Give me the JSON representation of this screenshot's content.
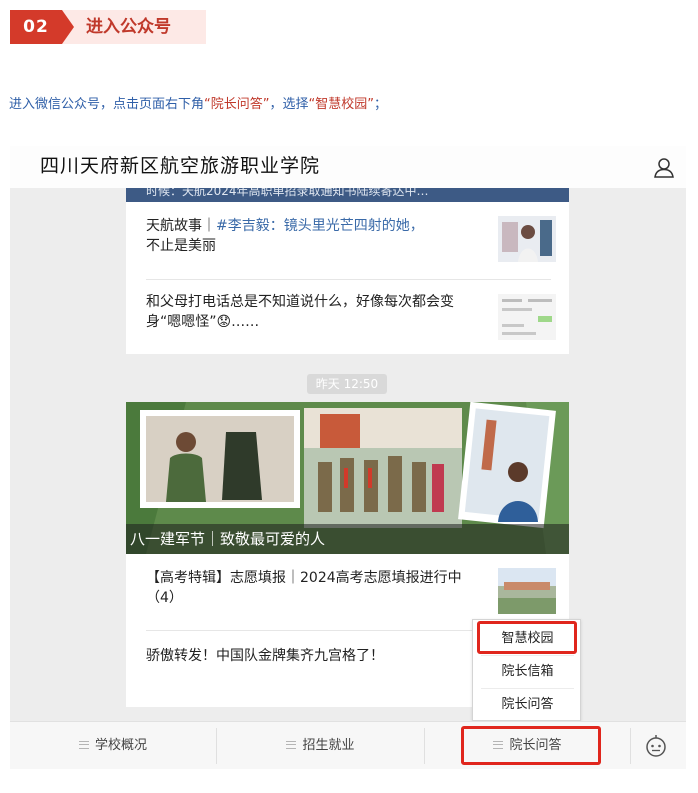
{
  "step": {
    "number": "02",
    "title": "进入公众号"
  },
  "instruction": {
    "part1": "进入微信公众号，点击页面右下角",
    "quote1": "“院长问答”",
    "part2": "，选择",
    "quote2": "“智慧校园”",
    "part3": "；"
  },
  "account": {
    "name": "四川天府新区航空旅游职业学院"
  },
  "feed": {
    "banner_text": "时候：天航2024年高职单招录取通知书陆续寄达中…",
    "articles_group1": [
      {
        "prefix": "天航故事｜",
        "link": "#李吉毅：镜头里光芒四射的她，",
        "rest": "不止是美丽"
      },
      {
        "text": "和父母打电话总是不知道说什么，好像每次都会变身“嗯嗯怪”😟……"
      }
    ],
    "timestamp": "昨天 12:50",
    "hero_caption": "八一建军节｜致敬最可爱的人",
    "articles_group2": [
      {
        "text": "【高考特辑】志愿填报｜2024高考志愿填报进行中（4）"
      },
      {
        "text": "骄傲转发！中国队金牌集齐九宫格了！"
      }
    ]
  },
  "popup_menu": {
    "items": [
      "智慧校园",
      "院长信箱",
      "院长问答"
    ]
  },
  "bottom_menu": {
    "items": [
      "学校概况",
      "招生就业",
      "院长问答"
    ]
  },
  "colors": {
    "accent_red": "#d43a2a",
    "highlight_box": "#e0261d",
    "instruction_blue": "#2f5fa8"
  }
}
